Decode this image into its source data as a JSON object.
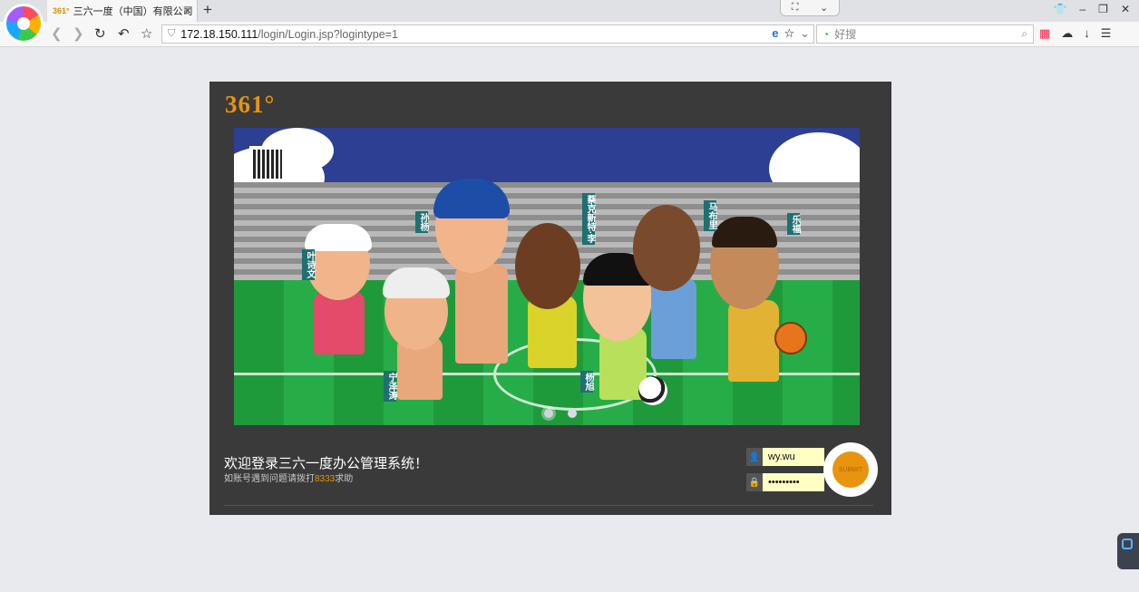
{
  "browser": {
    "tab_title": "三六一度（中国）有限公司",
    "tab_favicon": "361°",
    "new_tab": "+",
    "close": "×",
    "url_host": "172.18.150.111",
    "url_path": "/login/Login.jsp?logintype=1",
    "search_placeholder": "好搜"
  },
  "page": {
    "logo": "361°",
    "welcome": "欢迎登录三六一度办公管理系统！",
    "help_prefix": "如账号遇到问题请拨打",
    "help_number": "8333",
    "help_suffix": "求助",
    "username_value": "wy.wu",
    "password_value": "•••••••••",
    "submit_label": "SUBMIT"
  },
  "banner": {
    "name_tags": [
      "叶诗文",
      "孙杨",
      "宁泽涛",
      "蔡克新特·李",
      "杨旭",
      "马布里",
      "乐福"
    ],
    "carousel_dots": 2,
    "active_dot": 0
  },
  "colors": {
    "accent": "#e8940f",
    "panel": "#3a3a3a",
    "page_bg": "#e9eaed",
    "input_bg": "#ffffc4"
  }
}
